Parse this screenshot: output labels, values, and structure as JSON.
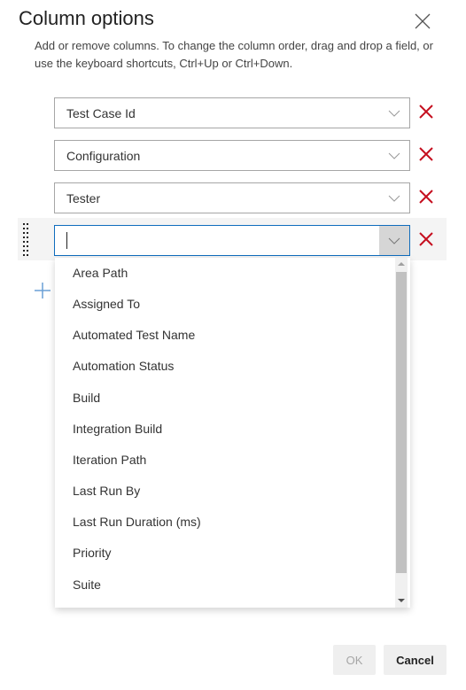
{
  "dialog": {
    "title": "Column options",
    "description": "Add or remove columns. To change the column order, drag and drop a field, or use the keyboard shortcuts, Ctrl+Up or Ctrl+Down.",
    "close_icon": "close-icon"
  },
  "columns": [
    {
      "value": "Test Case Id"
    },
    {
      "value": "Configuration"
    },
    {
      "value": "Tester"
    },
    {
      "value": "",
      "placeholder": ""
    }
  ],
  "dropdown": {
    "options": [
      "Area Path",
      "Assigned To",
      "Automated Test Name",
      "Automation Status",
      "Build",
      "Integration Build",
      "Iteration Path",
      "Last Run By",
      "Last Run Duration (ms)",
      "Priority",
      "Suite"
    ]
  },
  "icons": {
    "remove": "remove-x-icon",
    "chevron": "chevron-down-icon",
    "add": "add-plus-icon",
    "grip": "drag-grip-icon"
  },
  "colors": {
    "remove": "#c50f1f",
    "focus": "#0f6cbd",
    "add": "#6a9fd6"
  },
  "footer": {
    "ok_label": "OK",
    "cancel_label": "Cancel"
  }
}
